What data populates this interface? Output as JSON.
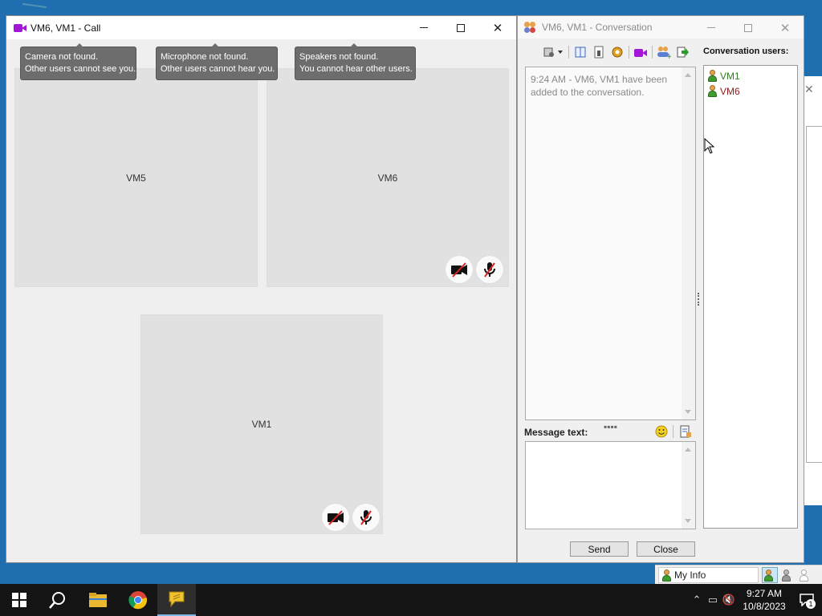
{
  "call_window": {
    "title": "VM6, VM1 - Call",
    "tooltips": [
      {
        "line1": "Camera not found.",
        "line2": "Other users cannot see you."
      },
      {
        "line1": "Microphone not found.",
        "line2": "Other users cannot hear you."
      },
      {
        "line1": "Speakers not found.",
        "line2": "You cannot hear other users."
      }
    ],
    "tiles": [
      {
        "name": "VM5"
      },
      {
        "name": "VM6"
      },
      {
        "name": "VM1"
      }
    ]
  },
  "conversation_window": {
    "title": "VM6, VM1 - Conversation",
    "chat_messages": [
      "9:24 AM - VM6, VM1 have been added to the conversation."
    ],
    "users_label": "Conversation users:",
    "users": [
      {
        "name": "VM1",
        "color": "#2f7d1e"
      },
      {
        "name": "VM6",
        "color": "#8b1b1b"
      }
    ],
    "message_label": "Message text:",
    "send_label": "Send",
    "close_label": "Close"
  },
  "myinfo": {
    "label": "My Info"
  },
  "taskbar": {
    "time": "9:27 AM",
    "date": "10/8/2023",
    "notifications": "1"
  },
  "colors": {
    "accent_purple": "#a316d8",
    "tooltip_bg": "#6d6d6d"
  }
}
